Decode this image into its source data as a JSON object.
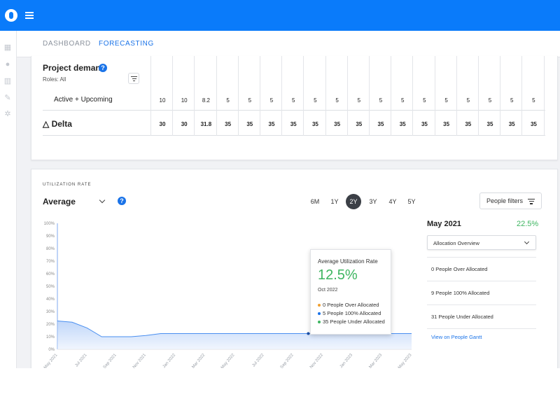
{
  "nav": {
    "tabs": [
      {
        "label": "DASHBOARD",
        "active": false
      },
      {
        "label": "FORECASTING",
        "active": true
      }
    ],
    "accent": "#0a7bfa"
  },
  "project_demand": {
    "title": "Project demand",
    "roles_label": "Roles: All",
    "rows": [
      {
        "label": "Active + Upcoming",
        "values": [
          "10",
          "10",
          "8.2",
          "5",
          "5",
          "5",
          "5",
          "5",
          "5",
          "5",
          "5",
          "5",
          "5",
          "5",
          "5",
          "5",
          "5",
          "5"
        ]
      },
      {
        "label": "△ Delta",
        "values": [
          "30",
          "30",
          "31.8",
          "35",
          "35",
          "35",
          "35",
          "35",
          "35",
          "35",
          "35",
          "35",
          "35",
          "35",
          "35",
          "35",
          "35",
          "35"
        ]
      }
    ]
  },
  "utilization": {
    "section_label": "UTILIZATION RATE",
    "metric": "Average",
    "ranges": [
      {
        "label": "6M",
        "active": false
      },
      {
        "label": "1Y",
        "active": false
      },
      {
        "label": "2Y",
        "active": true
      },
      {
        "label": "3Y",
        "active": false
      },
      {
        "label": "4Y",
        "active": false
      },
      {
        "label": "5Y",
        "active": false
      }
    ],
    "people_filters_label": "People filters",
    "tooltip": {
      "title": "Average Utilization Rate",
      "value": "12.5%",
      "date": "Oct 2022",
      "items": [
        {
          "label": "0 People Over Allocated",
          "color": "#f0a030"
        },
        {
          "label": "5 People 100% Allocated",
          "color": "#1a73e8"
        },
        {
          "label": "35 People Under Allocated",
          "color": "#3db560"
        }
      ]
    },
    "panel": {
      "month": "May 2021",
      "percent": "22.5%",
      "select_label": "Allocation Overview",
      "rows": [
        "0 People Over Allocated",
        "9 People 100% Allocated",
        "31 People Under Allocated"
      ],
      "link": "View on People Gantt"
    }
  },
  "chart_data": {
    "type": "area",
    "title": "",
    "xlabel": "",
    "ylabel": "",
    "ylim": [
      0,
      100
    ],
    "yticks": [
      "0%",
      "10%",
      "20%",
      "30%",
      "40%",
      "50%",
      "60%",
      "70%",
      "80%",
      "90%",
      "100%"
    ],
    "xticks": [
      "May 2021",
      "Jul 2021",
      "Sep 2021",
      "Nov 2021",
      "Jan 2022",
      "Mar 2022",
      "May 2022",
      "Jul 2022",
      "Sep 2022",
      "Nov 2022",
      "Jan 2023",
      "Mar 2023",
      "May 2023"
    ],
    "x": [
      "May 2021",
      "Jun 2021",
      "Jul 2021",
      "Aug 2021",
      "Sep 2021",
      "Oct 2021",
      "Nov 2021",
      "Dec 2021",
      "Jan 2022",
      "Feb 2022",
      "Mar 2022",
      "Apr 2022",
      "May 2022",
      "Jun 2022",
      "Jul 2022",
      "Aug 2022",
      "Sep 2022",
      "Oct 2022",
      "Nov 2022",
      "Dec 2022",
      "Jan 2023",
      "Feb 2023",
      "Mar 2023",
      "Apr 2023",
      "May 2023"
    ],
    "series": [
      {
        "values": [
          22.5,
          21.5,
          17,
          10,
          10,
          10,
          11,
          12.5,
          12.5,
          12.5,
          12.5,
          12.5,
          12.5,
          12.5,
          12.5,
          12.5,
          12.5,
          12.5,
          12.5,
          12.5,
          12.5,
          12.5,
          12.5,
          12.5,
          12.5
        ],
        "color": "#4a8ff0"
      }
    ],
    "highlight": {
      "x": "Oct 2022",
      "y": 12.5
    },
    "grid": false
  }
}
